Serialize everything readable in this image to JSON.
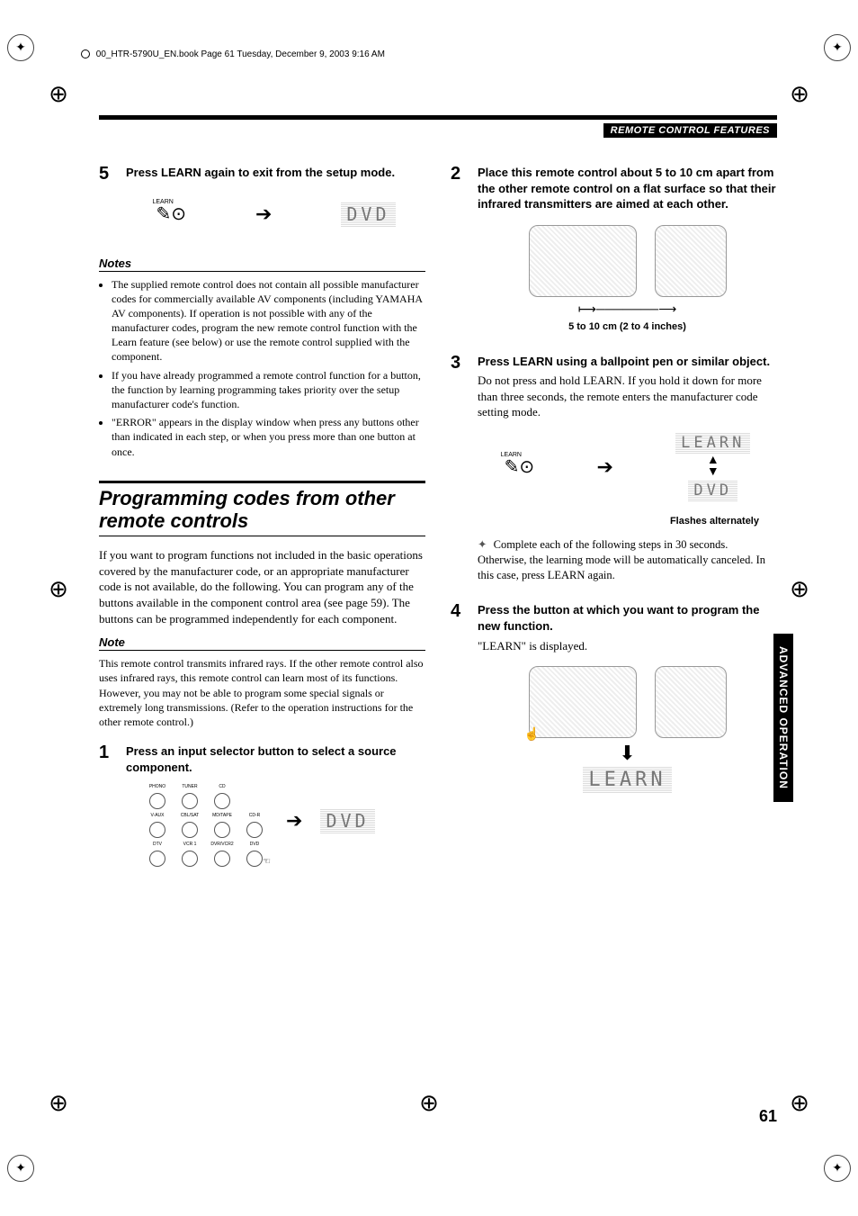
{
  "print_header": "00_HTR-5790U_EN.book  Page 61  Tuesday, December 9, 2003  9:16 AM",
  "section_header": "REMOTE CONTROL FEATURES",
  "side_tab": "ADVANCED OPERATION",
  "page_number": "61",
  "left": {
    "step5_num": "5",
    "step5_title": "Press LEARN again to exit from the setup mode.",
    "step5_learn_label": "LEARN",
    "step5_display": "DVD",
    "notes_heading": "Notes",
    "notes": [
      "The supplied remote control does not contain all possible manufacturer codes for commercially available AV components (including YAMAHA AV components). If operation is not possible with any of the manufacturer codes, program the new remote control function with the Learn feature (see below) or use the remote control supplied with the component.",
      "If you have already programmed a remote control function for a button, the function by learning programming takes priority over the setup manufacturer code's function.",
      "\"ERROR\" appears in the display window when press any buttons other than indicated in each step, or when you press more than one button at once."
    ],
    "section_title": "Programming codes from other remote controls",
    "intro": "If you want to program functions not included in the basic operations covered by the manufacturer code, or an appropriate manufacturer code is not available, do the following. You can program any of the buttons available in the component control area (see page 59). The buttons can be programmed independently for each component.",
    "note_heading": "Note",
    "note_text": "This remote control transmits infrared rays. If the other remote control also uses infrared rays, this remote control can learn most of its functions. However, you may not be able to program some special signals or extremely long transmissions. (Refer to the operation instructions for the other remote control.)",
    "step1_num": "1",
    "step1_title": "Press an input selector button to select a source component.",
    "step1_display": "DVD",
    "selector_labels": [
      "PHONO",
      "TUNER",
      "CD",
      "",
      "V-AUX",
      "CBL/SAT",
      "MD/TAPE",
      "CD-R",
      "DTV",
      "VCR 1",
      "DVR/VCR2",
      "DVD"
    ]
  },
  "right": {
    "step2_num": "2",
    "step2_title": "Place this remote control about 5 to 10 cm apart from the other remote control on a flat surface so that their infrared transmitters are aimed at each other.",
    "distance_caption": "5 to 10 cm (2 to 4 inches)",
    "step3_num": "3",
    "step3_title": "Press LEARN using a ballpoint pen or similar object.",
    "step3_text": "Do not press and hold LEARN. If you hold it down for more than three seconds, the remote enters the manufacturer code setting mode.",
    "step3_learn_label": "LEARN",
    "step3_display_top": "LEARN",
    "step3_display_bottom": "DVD",
    "step3_caption": "Flashes alternately",
    "tip_text": "Complete each of the following steps in 30 seconds. Otherwise, the learning mode will be automatically canceled. In this case, press LEARN again.",
    "step4_num": "4",
    "step4_title": "Press the button at which you want to program the new function.",
    "step4_text": "\"LEARN\" is displayed.",
    "step4_display": "LEARN"
  }
}
